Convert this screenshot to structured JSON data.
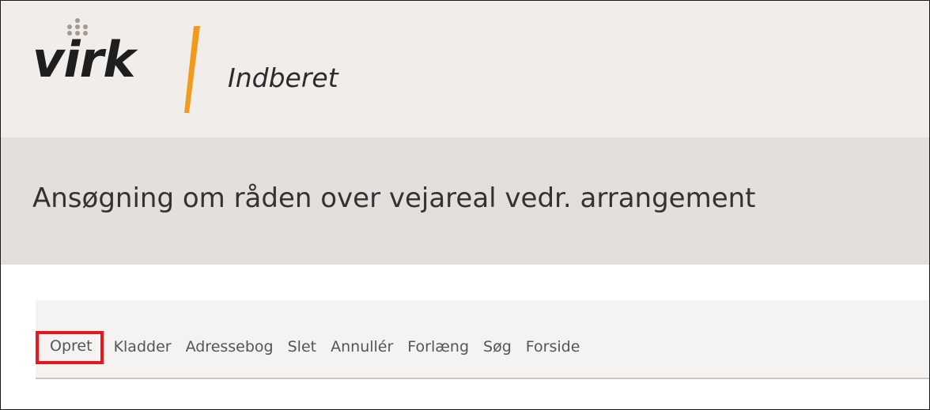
{
  "header": {
    "logo_text": "virk",
    "app_title": "Indberet"
  },
  "page": {
    "title": "Ansøgning om råden over vejareal vedr. arrangement"
  },
  "menu": {
    "items": [
      {
        "label": "Opret",
        "highlighted": true
      },
      {
        "label": "Kladder"
      },
      {
        "label": "Adressebog"
      },
      {
        "label": "Slet"
      },
      {
        "label": "Annullér"
      },
      {
        "label": "Forlæng"
      },
      {
        "label": "Søg"
      },
      {
        "label": "Forside"
      }
    ]
  },
  "colors": {
    "topbar_bg": "#f0edea",
    "header_bg": "#e2dfdc",
    "accent_orange": "#f29a1c",
    "highlight_red": "#e8161d"
  },
  "icons": {
    "logo": "virk-logo-icon",
    "slash": "orange-slash-divider"
  }
}
